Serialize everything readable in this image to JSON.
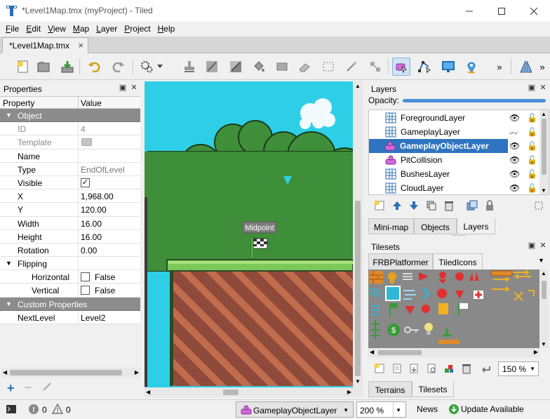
{
  "window": {
    "title": "*Level1Map.tmx (myProject) - Tiled",
    "minimize_icon": "minimize-icon",
    "maximize_icon": "maximize-icon",
    "close_icon": "close-icon"
  },
  "menu": {
    "items": [
      {
        "first": "F",
        "rest": "ile"
      },
      {
        "first": "E",
        "rest": "dit"
      },
      {
        "first": "V",
        "rest": "iew"
      },
      {
        "first": "M",
        "rest": "ap"
      },
      {
        "first": "L",
        "rest": "ayer"
      },
      {
        "first": "P",
        "rest": "roject"
      },
      {
        "first": "H",
        "rest": "elp"
      }
    ]
  },
  "document_tab": {
    "label": "*Level1Map.tmx",
    "close": "×"
  },
  "properties": {
    "title": "Properties",
    "col_property": "Property",
    "col_value": "Value",
    "groups": {
      "object": "Object",
      "flipping": "Flipping",
      "custom": "Custom Properties"
    },
    "rows": {
      "id": {
        "name": "ID",
        "value": "4"
      },
      "template": {
        "name": "Template",
        "value": ""
      },
      "name": {
        "name": "Name",
        "value": ""
      },
      "type": {
        "name": "Type",
        "value": "EndOfLevel"
      },
      "visible": {
        "name": "Visible",
        "value": "✓"
      },
      "x": {
        "name": "X",
        "value": "1,968.00"
      },
      "y": {
        "name": "Y",
        "value": "120.00"
      },
      "width": {
        "name": "Width",
        "value": "16.00"
      },
      "height": {
        "name": "Height",
        "value": "16.00"
      },
      "rotation": {
        "name": "Rotation",
        "value": "0.00"
      },
      "horizontal": {
        "name": "Horizontal",
        "value": "False"
      },
      "vertical": {
        "name": "Vertical",
        "value": "False"
      },
      "nextlevel": {
        "name": "NextLevel",
        "value": "Level2"
      }
    }
  },
  "map": {
    "object_label": "Midpoint",
    "colors": {
      "sky": "#2ecfe6",
      "bush": "#3f8f3a",
      "ground_dark": "#8e4a3a",
      "ground_stripe": "#c26c4e",
      "grass": "#7cc95a"
    }
  },
  "layers": {
    "title": "Layers",
    "opacity_label": "Opacity:",
    "items": [
      {
        "name": "ForegroundLayer",
        "kind": "tile"
      },
      {
        "name": "GameplayLayer",
        "kind": "tile"
      },
      {
        "name": "GameplayObjectLayer",
        "kind": "object",
        "selected": true
      },
      {
        "name": "PitCollision",
        "kind": "object"
      },
      {
        "name": "BushesLayer",
        "kind": "tile"
      },
      {
        "name": "CloudLayer",
        "kind": "tile"
      }
    ],
    "tabs": [
      "Mini-map",
      "Objects",
      "Layers"
    ]
  },
  "tilesets": {
    "title": "Tilesets",
    "tabs": [
      "FRBPlatformer",
      "TiledIcons"
    ],
    "zoom": "150 %",
    "bottom_tabs": [
      "Terrains",
      "Tilesets"
    ]
  },
  "status": {
    "errors": "0",
    "warnings": "0",
    "layer": "GameplayObjectLayer",
    "zoom": "200 %",
    "news": "News",
    "update": "Update Available"
  }
}
